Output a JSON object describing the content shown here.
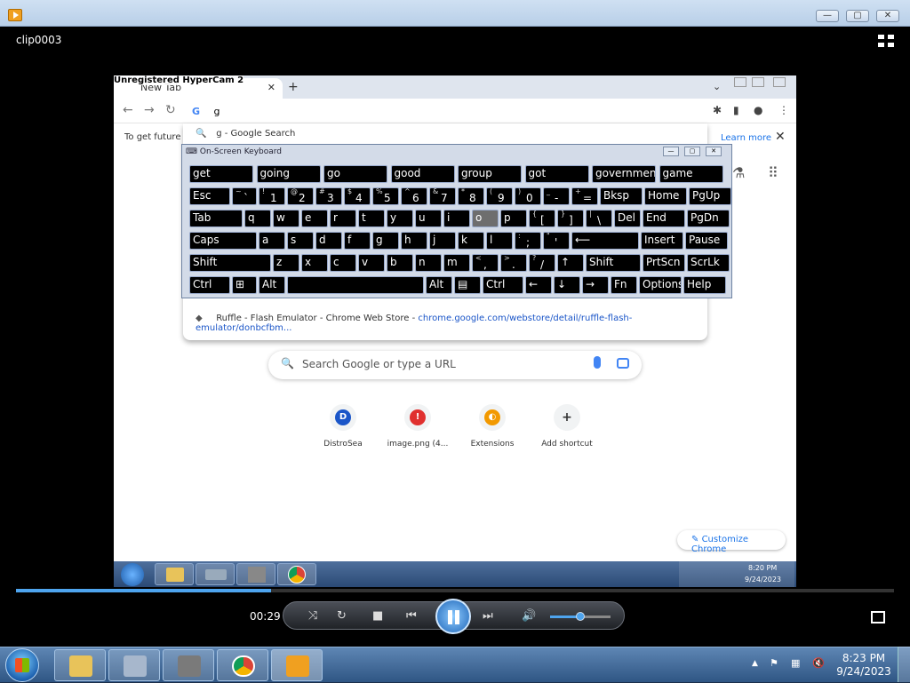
{
  "window": {
    "title": "",
    "clip_name": "clip0003",
    "btn_min": "—",
    "btn_max": "▢",
    "btn_close": "✕"
  },
  "video": {
    "watermark": "Unregistered HyperCam 2",
    "tab": {
      "label": "New Tab",
      "close": "✕",
      "new": "+",
      "chevron": "⌄"
    },
    "omnibox": {
      "g": "G",
      "value": "g"
    },
    "infobar": {
      "text": "To get future G",
      "learn_more": "Learn more",
      "close": "✕"
    },
    "dropdown": {
      "first": {
        "icon": "🔍",
        "text": "g - Google Search"
      },
      "last": {
        "text": "Ruffle - Flash Emulator - Chrome Web Store - ",
        "url": "chrome.google.com/webstore/detail/ruffle-flash-emulator/donbcfbm..."
      }
    },
    "search_placeholder": "Search Google or type a URL",
    "shortcuts": [
      {
        "label": "DistroSea",
        "letter": "D",
        "color": "#1a55c8"
      },
      {
        "label": "image.png (4...",
        "letter": "!",
        "color": "#e0302f"
      },
      {
        "label": "Extensions",
        "letter": "◐",
        "color": "#f29900"
      },
      {
        "label": "Add shortcut",
        "letter": "+",
        "color": "#f1f3f4"
      }
    ],
    "customize": "Customize Chrome",
    "tray_time": "8:20 PM",
    "tray_date": "9/24/2023"
  },
  "osk": {
    "title": "On-Screen Keyboard",
    "suggestions": [
      "get",
      "going",
      "go",
      "good",
      "group",
      "got",
      "government",
      "game"
    ],
    "row1": [
      {
        "main": "Esc"
      },
      {
        "shift": "~",
        "main": "`"
      },
      {
        "shift": "!",
        "main": "1"
      },
      {
        "shift": "@",
        "main": "2"
      },
      {
        "shift": "#",
        "main": "3"
      },
      {
        "shift": "$",
        "main": "4"
      },
      {
        "shift": "%",
        "main": "5"
      },
      {
        "shift": "^",
        "main": "6"
      },
      {
        "shift": "&",
        "main": "7"
      },
      {
        "shift": "*",
        "main": "8"
      },
      {
        "shift": "(",
        "main": "9"
      },
      {
        "shift": ")",
        "main": "0"
      },
      {
        "shift": "_",
        "main": "-"
      },
      {
        "shift": "+",
        "main": "="
      },
      {
        "main": "Bksp"
      },
      {
        "main": "Home"
      },
      {
        "main": "PgUp"
      }
    ],
    "row2": [
      {
        "main": "Tab"
      },
      {
        "main": "q"
      },
      {
        "main": "w"
      },
      {
        "main": "e"
      },
      {
        "main": "r"
      },
      {
        "main": "t"
      },
      {
        "main": "y"
      },
      {
        "main": "u"
      },
      {
        "main": "i"
      },
      {
        "main": "o"
      },
      {
        "main": "p"
      },
      {
        "shift": "{",
        "main": "["
      },
      {
        "shift": "}",
        "main": "]"
      },
      {
        "shift": "|",
        "main": "\\"
      },
      {
        "main": "Del"
      },
      {
        "main": "End"
      },
      {
        "main": "PgDn"
      }
    ],
    "row3": [
      {
        "main": "Caps"
      },
      {
        "main": "a"
      },
      {
        "main": "s"
      },
      {
        "main": "d"
      },
      {
        "main": "f"
      },
      {
        "main": "g"
      },
      {
        "main": "h"
      },
      {
        "main": "j"
      },
      {
        "main": "k"
      },
      {
        "main": "l"
      },
      {
        "shift": ":",
        "main": ";"
      },
      {
        "shift": "\"",
        "main": "'"
      },
      {
        "main": "⟵"
      },
      {
        "main": "Insert"
      },
      {
        "main": "Pause"
      }
    ],
    "row4": [
      {
        "main": "Shift"
      },
      {
        "main": "z"
      },
      {
        "main": "x"
      },
      {
        "main": "c"
      },
      {
        "main": "v"
      },
      {
        "main": "b"
      },
      {
        "main": "n"
      },
      {
        "main": "m"
      },
      {
        "shift": "<",
        "main": ","
      },
      {
        "shift": ">",
        "main": "."
      },
      {
        "shift": "?",
        "main": "/"
      },
      {
        "main": "↑"
      },
      {
        "main": "Shift"
      },
      {
        "main": "PrtScn"
      },
      {
        "main": "ScrLk"
      }
    ],
    "row5": [
      {
        "main": "Ctrl"
      },
      {
        "main": "⊞"
      },
      {
        "main": "Alt"
      },
      {
        "main": ""
      },
      {
        "main": "Alt"
      },
      {
        "main": "▤"
      },
      {
        "main": "Ctrl"
      },
      {
        "main": "←"
      },
      {
        "main": "↓"
      },
      {
        "main": "→"
      },
      {
        "main": "Fn"
      },
      {
        "main": "Options"
      },
      {
        "main": "Help"
      }
    ]
  },
  "player": {
    "elapsed": "00:29",
    "progress_fraction": 0.29,
    "volume_fraction": 0.5
  },
  "taskbar": {
    "time": "8:23 PM",
    "date": "9/24/2023",
    "tray_arrow": "▲"
  }
}
